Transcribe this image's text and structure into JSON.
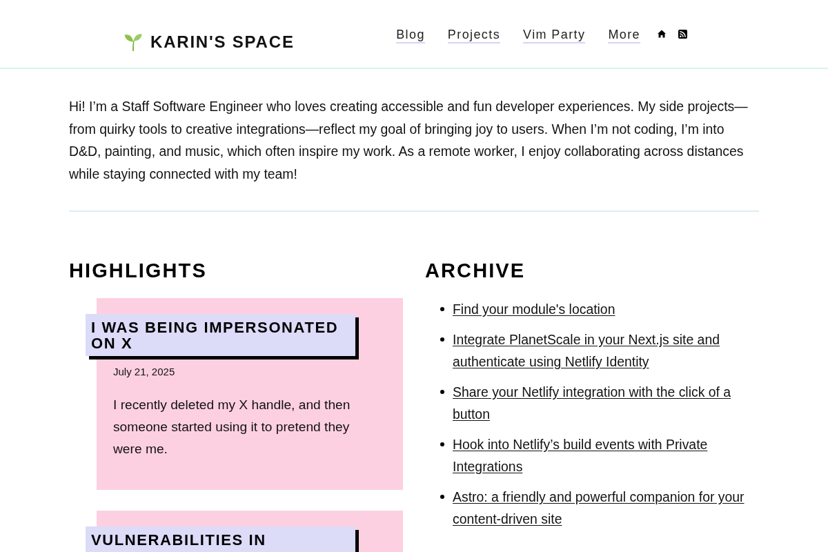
{
  "header": {
    "site_title": "KARIN'S SPACE",
    "nav": [
      "Blog",
      "Projects",
      "Vim Party",
      "More"
    ]
  },
  "intro": "Hi! I’m a Staff Software Engineer who loves creating accessible and fun developer experiences. My side projects—from quirky tools to creative integrations—reflect my goal of bringing joy to users. When I’m not coding, I’m into D&D, painting, and music, which often inspire my work. As a remote worker, I enjoy collaborating across distances while staying connected with my team!",
  "highlights": {
    "title": "HIGHLIGHTS",
    "posts": [
      {
        "title": "I WAS BEING IMPERSONATED ON X",
        "date": "July 21, 2025",
        "summary": "I recently deleted my X handle, and then someone started using it to pretend they were me."
      },
      {
        "title": "VULNERABILITIES IN"
      }
    ]
  },
  "archive": {
    "title": "ARCHIVE",
    "links": [
      "Find your module's location",
      "Integrate PlanetScale in your Next.js site and authenticate using Netlify Identity",
      "Share your Netlify integration with the click of a button",
      "Hook into Netlify’s build events with Private Integrations",
      "Astro: a friendly and powerful companion for your content-driven site"
    ]
  }
}
